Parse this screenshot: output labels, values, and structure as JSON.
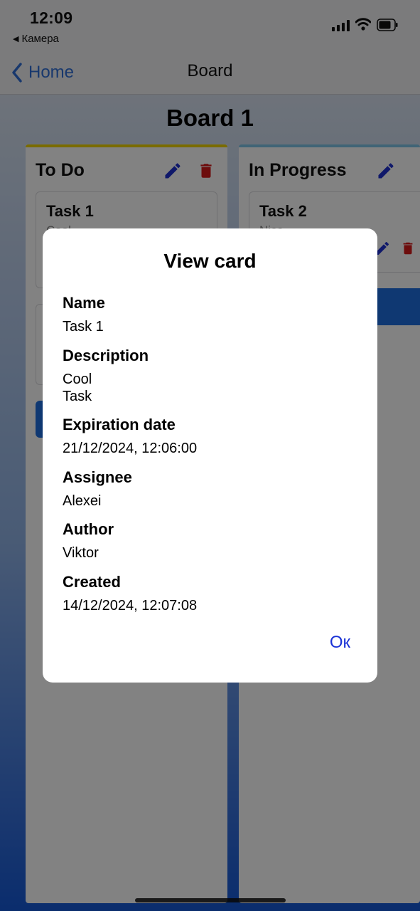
{
  "status_bar": {
    "time": "12:09",
    "back_app": "Камера",
    "back_app_icon": "triangle-left-icon",
    "signal_icon": "cellular-signal-icon",
    "wifi_icon": "wifi-icon",
    "battery_icon": "battery-icon"
  },
  "nav": {
    "back_label": "Home",
    "back_icon": "chevron-left-icon",
    "title": "Board",
    "accent_color": "#2f6fd6"
  },
  "board": {
    "title": "Board 1",
    "columns": [
      {
        "title": "To Do",
        "color": "#f0d400",
        "cards": [
          {
            "title": "Task 1",
            "subtitle": "Cool"
          }
        ]
      },
      {
        "title": "In Progress",
        "color": "#7ec4e8",
        "cards": [
          {
            "title": "Task 2",
            "subtitle": "Nice"
          }
        ]
      }
    ]
  },
  "modal": {
    "title": "View card",
    "fields": [
      {
        "label": "Name",
        "value": "Task 1"
      },
      {
        "label": "Description",
        "value_lines": [
          "Cool",
          "Task"
        ]
      },
      {
        "label": "Expiration date",
        "value": "21/12/2024, 12:06:00"
      },
      {
        "label": "Assignee",
        "value": "Alexei"
      },
      {
        "label": "Author",
        "value": "Viktor"
      },
      {
        "label": "Created",
        "value": "14/12/2024, 12:07:08"
      }
    ],
    "ok_label": "Ок",
    "ok_color": "#1a32d6"
  }
}
